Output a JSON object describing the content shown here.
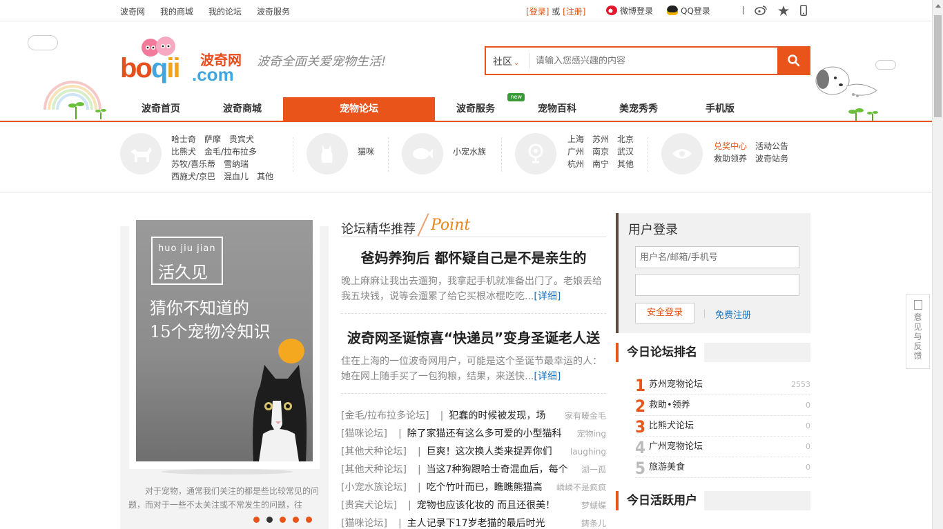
{
  "topbar": {
    "links": [
      "波奇网",
      "我的商城",
      "我的论坛",
      "波奇服务"
    ],
    "login": "登录",
    "or": "或",
    "register": "注册",
    "weibo": "微博登录",
    "qq": "QQ登录"
  },
  "header": {
    "logo_text": "波奇网",
    "logo_domain": ".com",
    "logo_bo": "bo",
    "logo_q": "q",
    "logo_ii": "ii",
    "slogan": "波奇全面关爱宠物生活!",
    "search": {
      "scope": "社区",
      "placeholder": "请输入您感兴趣的内容"
    }
  },
  "nav": {
    "items": [
      "波奇首页",
      "波奇商城",
      "宠物论坛",
      "波奇服务",
      "宠物百科",
      "美宠秀秀",
      "手机版"
    ],
    "active": "宠物论坛",
    "badge": "new"
  },
  "categories": {
    "dogs": [
      [
        "哈士奇",
        "萨摩",
        "贵宾犬"
      ],
      [
        "比熊犬",
        "金毛/拉布拉多"
      ],
      [
        "苏牧/喜乐蒂",
        "雪纳瑞"
      ],
      [
        "西施犬/京巴",
        "混血儿",
        "其他"
      ]
    ],
    "cat": "猫咪",
    "small": "小宠水族",
    "cities": [
      [
        "上海",
        "苏州",
        "北京"
      ],
      [
        "广州",
        "南京",
        "武汉"
      ],
      [
        "杭州",
        "南宁",
        "其他"
      ]
    ],
    "misc": [
      [
        "兑奖中心",
        "活动公告"
      ],
      [
        "救助领养",
        "波奇站务"
      ]
    ]
  },
  "promo": {
    "pinyin": "huo jiu jian",
    "brand": "活久见",
    "line1": "猜你不知道的",
    "line2": "15个宠物冷知识",
    "desc": "对于宠物，通常我们关注的都是些比较常见的问题，而对于一些不太关注或不常发生的问题，往",
    "slides": 5,
    "active_slide": 2
  },
  "center": {
    "title": "论坛精华推荐",
    "title_en": "Point",
    "articles": [
      {
        "title": "爸妈养狗后 都怀疑自己是不是亲生的",
        "summary": "晚上麻麻让我出去遛狗，我拿起手机就准备出门了。老娘丢给我五块钱，说等会遛累了给它买根冰棍吃吃...",
        "more": "[详细]"
      },
      {
        "title": "波奇网圣诞惊喜“快递员”变身圣诞老人送",
        "summary": "住在上海的一位波奇网用户，可能是这个圣诞节最幸运的人：她在网上随手买了一包狗粮，结果，来送快...",
        "more": "[详细]"
      }
    ],
    "list": [
      {
        "forum": "[金毛/拉布拉多论坛]",
        "title": "犯蠢的时候被发现，场",
        "author": "家有暖金毛"
      },
      {
        "forum": "[猫咪论坛]",
        "title": "除了家猫还有这么多可爱的小型猫科",
        "author": "宠物ing"
      },
      {
        "forum": "[其他犬种论坛]",
        "title": "巨爽！这次换人类来捉弄你们",
        "author": "laughing"
      },
      {
        "forum": "[其他犬种论坛]",
        "title": "当这7种狗跟哈士奇混血后，每个",
        "author": "湖一孤"
      },
      {
        "forum": "[小宠水族论坛]",
        "title": "吃个竹叶而已，瞧瞧熊猫高",
        "author": "嶙嶙不是疯疯"
      },
      {
        "forum": "[贵宾犬论坛]",
        "title": "宠物也应该化妆的 而且还很美！",
        "author": "梦蝴蝶"
      },
      {
        "forum": "[猫咪论坛]",
        "title": "主人记录下17岁老猫的最后时光",
        "author": "鋳条儿"
      }
    ]
  },
  "login": {
    "title": "用户登录",
    "user_placeholder": "用户名/邮箱/手机号",
    "pass_placeholder": "",
    "submit": "安全登录",
    "register": "免费注册"
  },
  "ranking": {
    "title": "今日论坛排名",
    "rows": [
      {
        "n": "1",
        "name": "苏州宠物论坛",
        "v": "2553",
        "color": "#e8541a"
      },
      {
        "n": "2",
        "name": "救助•领养",
        "v": "0",
        "color": "#e8541a"
      },
      {
        "n": "3",
        "name": "比熊犬论坛",
        "v": "0",
        "color": "#e8541a"
      },
      {
        "n": "4",
        "name": "广州宠物论坛",
        "v": "0",
        "color": "#bbbbbb"
      },
      {
        "n": "5",
        "name": "旅游美食",
        "v": "0",
        "color": "#bbbbbb"
      }
    ]
  },
  "active_users": {
    "title": "今日活跃用户"
  },
  "feedback": "意见与反馈"
}
